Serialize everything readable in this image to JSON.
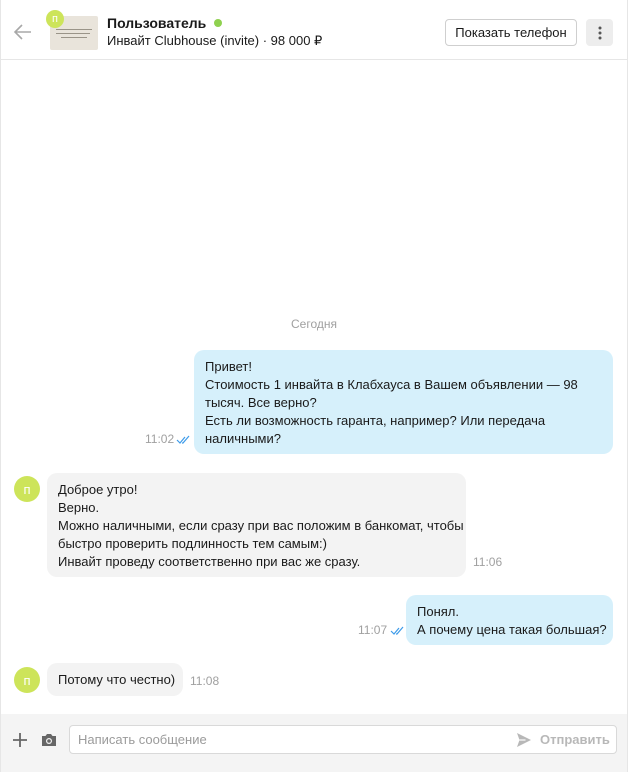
{
  "header": {
    "user_name": "Пользователь",
    "avatar_letter": "п",
    "listing": "Инвайт Clubhouse (invite) · 98 000 ₽",
    "phone_button": "Показать телефон",
    "online_color": "#8fd14f"
  },
  "chat": {
    "day_label": "Сегодня",
    "messages": [
      {
        "direction": "out",
        "lines": [
          "Привет!",
          "Стоимость 1 инвайта в Клабхауса в Вашем объявлении — 98",
          "тысяч. Все верно?",
          "Есть ли возможность гаранта, например? Или передача",
          "наличными?"
        ],
        "time": "11:02",
        "read": true
      },
      {
        "direction": "in",
        "avatar_letter": "п",
        "lines": [
          "Доброе утро!",
          "Верно.",
          "Можно наличными, если сразу при вас положим в банкомат, чтобы",
          "быстро проверить подлинность тем самым:)",
          "Инвайт проведу соответственно при вас же сразу."
        ],
        "time": "11:06"
      },
      {
        "direction": "out",
        "lines": [
          "Понял.",
          "А почему цена такая большая?"
        ],
        "time": "11:07",
        "read": true
      },
      {
        "direction": "in",
        "avatar_letter": "п",
        "lines": [
          "Потому что честно)"
        ],
        "time": "11:08"
      }
    ]
  },
  "composer": {
    "placeholder": "Написать сообщение",
    "send_label": "Отправить"
  },
  "icons": {
    "back": "arrow-left-icon",
    "more": "vertical-dots-icon",
    "read": "double-check-icon",
    "attach": "plus-icon",
    "camera": "camera-icon",
    "send": "paper-plane-icon"
  },
  "colors": {
    "outgoing_bubble": "#d6f0fb",
    "incoming_bubble": "#f3f3f3",
    "avatar": "#cde45a",
    "read_ticks": "#3d9be9"
  }
}
